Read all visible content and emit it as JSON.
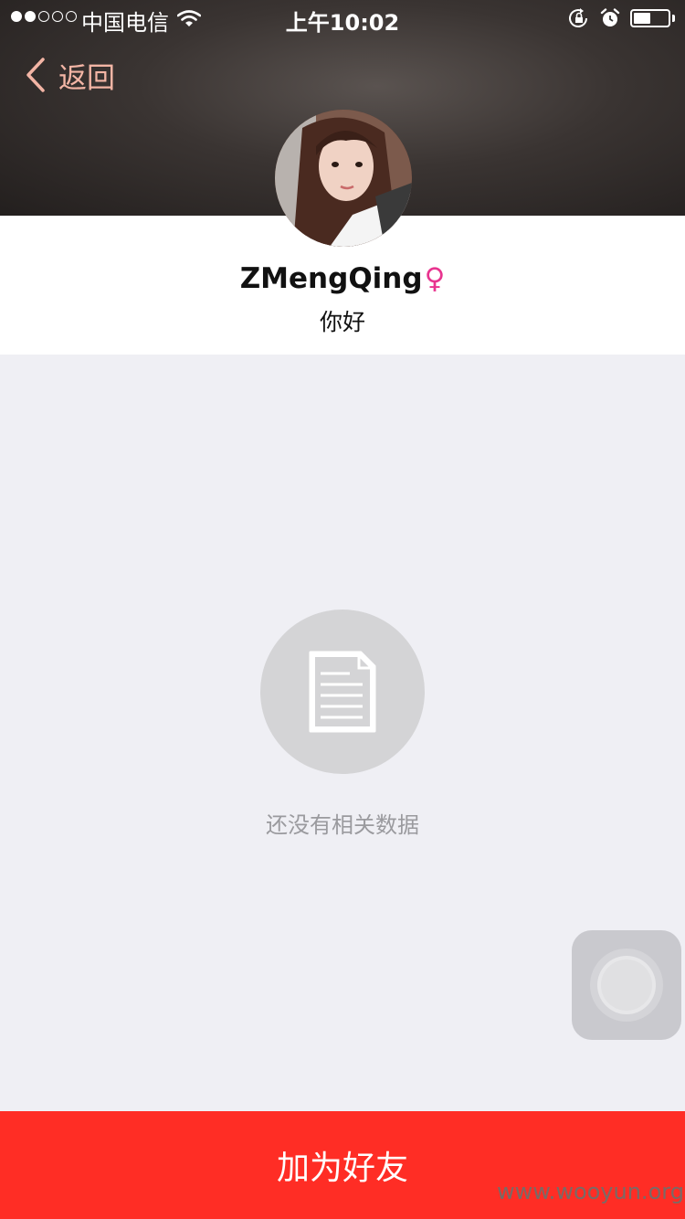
{
  "status_bar": {
    "carrier": "中国电信",
    "time": "上午10:02",
    "signal_filled": 2,
    "signal_total": 5,
    "battery_level": 0.5,
    "icons": [
      "wifi-icon",
      "orientation-lock-icon",
      "alarm-icon",
      "battery-icon"
    ]
  },
  "nav": {
    "back_label": "返回"
  },
  "profile": {
    "name": "ZMengQing",
    "gender_symbol": "♀",
    "bio": "你好"
  },
  "empty_state": {
    "icon": "document-icon",
    "message": "还没有相关数据"
  },
  "actions": {
    "add_friend_label": "加为好友"
  },
  "watermark": "www.wooyun.org",
  "colors": {
    "accent_red": "#ff2d25",
    "gender_pink": "#e8348f",
    "back_text": "#f3b5a5",
    "background": "#efeff4"
  }
}
